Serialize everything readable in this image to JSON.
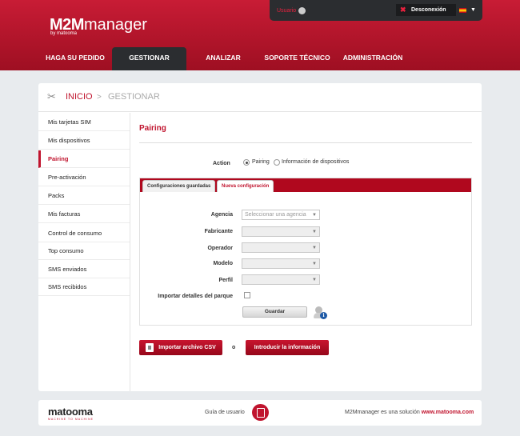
{
  "brand": {
    "name_bold": "M2M",
    "name_rest": "manager",
    "by": "by matooma"
  },
  "userbar": {
    "user": "Usuario",
    "logout": "Desconexión"
  },
  "nav": {
    "items": [
      {
        "label": "HAGA SU PEDIDO",
        "active": false
      },
      {
        "label": "GESTIONAR",
        "active": true
      },
      {
        "label": "ANALIZAR",
        "active": false
      },
      {
        "label": "SOPORTE TÉCNICO",
        "active": false
      },
      {
        "label": "ADMINISTRACIÓN",
        "active": false
      }
    ]
  },
  "breadcrumb": {
    "home": "INICIO",
    "sep": ">",
    "current": "GESTIONAR"
  },
  "sidebar": {
    "items": [
      {
        "label": "Mis tarjetas SIM"
      },
      {
        "label": "Mis dispositivos"
      },
      {
        "label": "Pairing"
      },
      {
        "label": "Pre-activación"
      },
      {
        "label": "Packs"
      },
      {
        "label": "Mis facturas"
      },
      {
        "label": "Control de consumo"
      },
      {
        "label": "Top consumo"
      },
      {
        "label": "SMS enviados"
      },
      {
        "label": "SMS recibidos"
      }
    ],
    "active_index": 2
  },
  "page": {
    "title": "Pairing",
    "action_label": "Action",
    "radio_pairing": "Pairing",
    "radio_info": "Información de dispositivos",
    "tab_saved": "Configuraciones guardadas",
    "tab_new": "Nueva configuración",
    "fields": {
      "agency": {
        "label": "Agencia",
        "placeholder": "Seleccionar una agencia"
      },
      "manufacturer": {
        "label": "Fabricante",
        "value": ""
      },
      "operator": {
        "label": "Operador",
        "value": ""
      },
      "model": {
        "label": "Modelo",
        "value": ""
      },
      "profile": {
        "label": "Perfil",
        "value": ""
      },
      "import": {
        "label": "Importar detalles del parque",
        "checked": false
      }
    },
    "save_label": "Guardar",
    "import_csv": "Importar archivo CSV",
    "or": "o",
    "enter_info": "Introducir la información"
  },
  "footer": {
    "logo": "matooma",
    "tagline": "MACHINE TO MACHINE",
    "guide": "Guía de usuario",
    "solution_text": "M2Mmanager es una solución ",
    "solution_url": "www.matooma.com"
  },
  "colors": {
    "brand_red": "#c0142e",
    "dark": "#2b2d30"
  }
}
